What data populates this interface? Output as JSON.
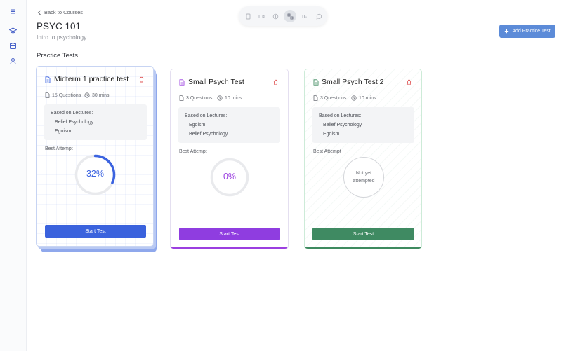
{
  "sidebar": {
    "items": [
      {
        "icon": "menu-icon"
      },
      {
        "icon": "graduation-cap-icon"
      },
      {
        "icon": "calendar-icon"
      },
      {
        "icon": "user-icon"
      }
    ]
  },
  "header": {
    "back_label": "Back to Courses",
    "course_title": "PSYC 101",
    "course_subtitle": "Intro to psychology",
    "section_title": "Practice Tests",
    "add_button_label": "Add Practice Test"
  },
  "toolbar": {
    "tools": [
      {
        "icon": "book-icon"
      },
      {
        "icon": "video-icon"
      },
      {
        "icon": "coin-icon"
      },
      {
        "icon": "flashcards-icon",
        "active": true
      },
      {
        "icon": "chart-icon"
      },
      {
        "icon": "chat-icon"
      }
    ]
  },
  "tests": [
    {
      "title": "Midterm 1 practice test",
      "questions": "15 Questions",
      "duration": "30 mins",
      "lectures_label": "Based on Lectures:",
      "lectures": [
        "Belief Psychology",
        "Egoism"
      ],
      "best_attempt_label": "Best Attempt",
      "score_text": "32%",
      "score_value": 0.32,
      "button_label": "Start Test",
      "accent": "#3b63e0",
      "button_color": "#3a62dd"
    },
    {
      "title": "Small Psych Test",
      "questions": "3 Questions",
      "duration": "10 mins",
      "lectures_label": "Based on Lectures:",
      "lectures": [
        "Egoism",
        "Belief Psychology"
      ],
      "best_attempt_label": "Best Attempt",
      "score_text": "0%",
      "score_value": 0,
      "button_label": "Start Test",
      "accent": "#9b3fe0",
      "button_color": "#8f3de0"
    },
    {
      "title": "Small Psych Test 2",
      "questions": "3 Questions",
      "duration": "10 mins",
      "lectures_label": "Based on Lectures:",
      "lectures": [
        "Belief Psychology",
        "Egoism"
      ],
      "best_attempt_label": "Best Attempt",
      "not_attempted_line1": "Not yet",
      "not_attempted_line2": "attempted",
      "button_label": "Start Test",
      "accent": "#3e8a5f",
      "button_color": "#3f8a62"
    }
  ]
}
